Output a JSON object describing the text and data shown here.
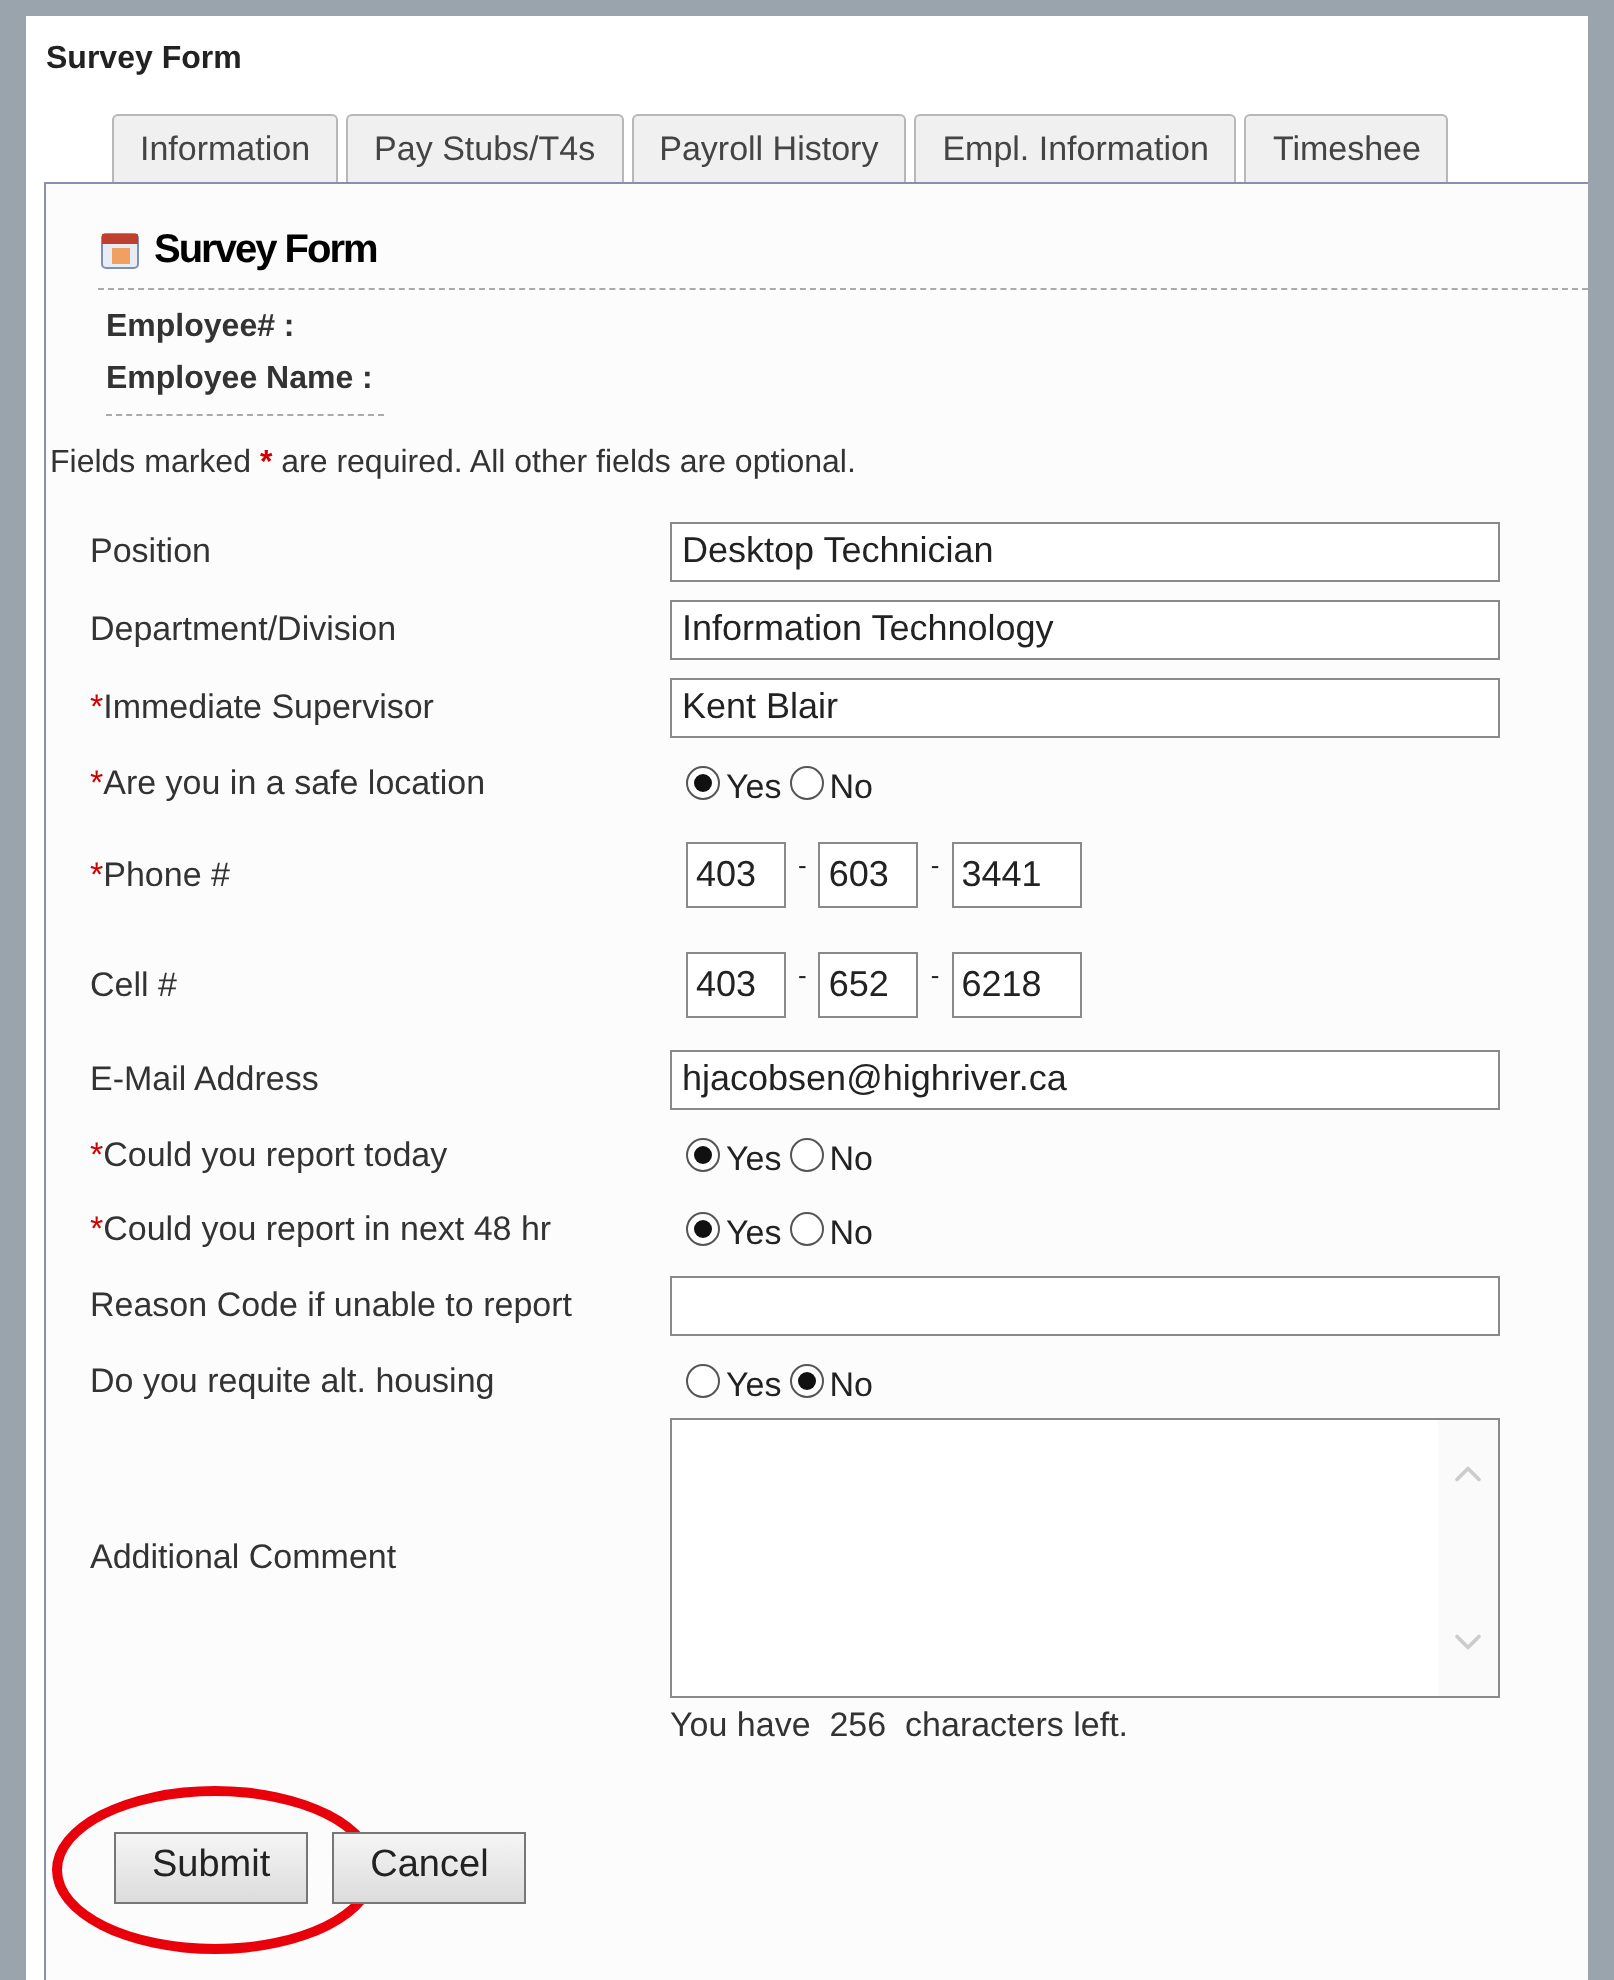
{
  "window": {
    "title": "Survey Form"
  },
  "tabs": [
    {
      "label": "Information",
      "selected": false
    },
    {
      "label": "Pay Stubs/T4s",
      "selected": false
    },
    {
      "label": "Payroll History",
      "selected": false
    },
    {
      "label": "Empl. Information",
      "selected": false
    },
    {
      "label": "Timeshee",
      "selected": false
    }
  ],
  "panel": {
    "title": "Survey Form",
    "employee_fields": [
      "Employee# :",
      "Employee Name :"
    ],
    "notice": {
      "before": "Fields marked",
      "mark": "*",
      "after": "are required. All other fields are optional."
    }
  },
  "form_rows": [
    {
      "kind": "text",
      "label": "Position",
      "required": false,
      "value": "Desktop Technician"
    },
    {
      "kind": "text",
      "label": "Department/Division",
      "required": false,
      "value": "Information Technology"
    },
    {
      "kind": "text",
      "label": "Immediate Supervisor",
      "required": true,
      "value": "Kent Blair"
    },
    {
      "kind": "radio",
      "label": "Are you in a safe location",
      "required": true,
      "options": [
        {
          "label": "Yes",
          "selected": true
        },
        {
          "label": "No",
          "selected": false
        }
      ]
    },
    {
      "kind": "phone",
      "label": "Phone #",
      "required": true,
      "parts": [
        "403",
        "603",
        "3441"
      ],
      "separator": "-"
    },
    {
      "kind": "phone",
      "label": "Cell #",
      "required": false,
      "parts": [
        "403",
        "652",
        "6218"
      ],
      "separator": "-"
    },
    {
      "kind": "text",
      "label": "E-Mail Address",
      "required": false,
      "value": "hjacobsen@highriver.ca"
    },
    {
      "kind": "radio",
      "label": "Could you report today",
      "required": true,
      "options": [
        {
          "label": "Yes",
          "selected": true
        },
        {
          "label": "No",
          "selected": false
        }
      ]
    },
    {
      "kind": "radio",
      "label": "Could you report in next 48 hr",
      "required": true,
      "options": [
        {
          "label": "Yes",
          "selected": true
        },
        {
          "label": "No",
          "selected": false
        }
      ]
    },
    {
      "kind": "text",
      "label": "Reason Code if unable to report",
      "required": false
    },
    {
      "kind": "radio",
      "label": "Do you requite alt. housing",
      "required": false,
      "options": [
        {
          "label": "Yes",
          "selected": false
        },
        {
          "label": "No",
          "selected": true
        }
      ]
    },
    {
      "kind": "textarea",
      "label": "Additional Comment",
      "required": false,
      "counter": "You have  256  characters left."
    }
  ],
  "buttons": [
    {
      "label": "Submit",
      "highlighted": true
    },
    {
      "label": "Cancel",
      "highlighted": false
    }
  ]
}
